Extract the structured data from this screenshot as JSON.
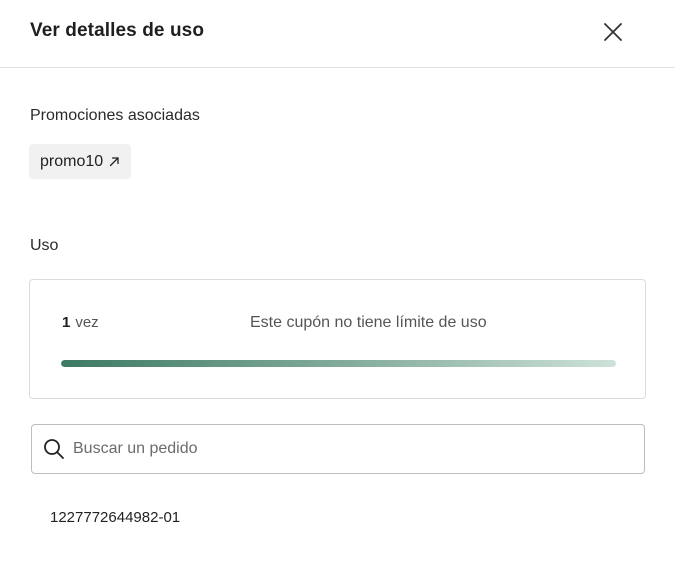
{
  "header": {
    "title": "Ver detalles de uso",
    "close_icon": "close-icon"
  },
  "promotions": {
    "label": "Promociones asociadas",
    "items": [
      {
        "label": "promo10",
        "icon": "external-link-arrow-icon"
      }
    ]
  },
  "usage": {
    "label": "Uso",
    "count": "1",
    "count_unit": "vez",
    "limit_text": "Este cupón no tiene límite de uso",
    "progress_fraction": 1.0,
    "progress_colors": [
      "#3d7a63",
      "#cde2d8"
    ]
  },
  "search": {
    "placeholder": "Buscar un pedido",
    "value": "",
    "icon": "search-icon"
  },
  "orders": {
    "items": [
      {
        "id": "1227772644982-01"
      }
    ]
  }
}
